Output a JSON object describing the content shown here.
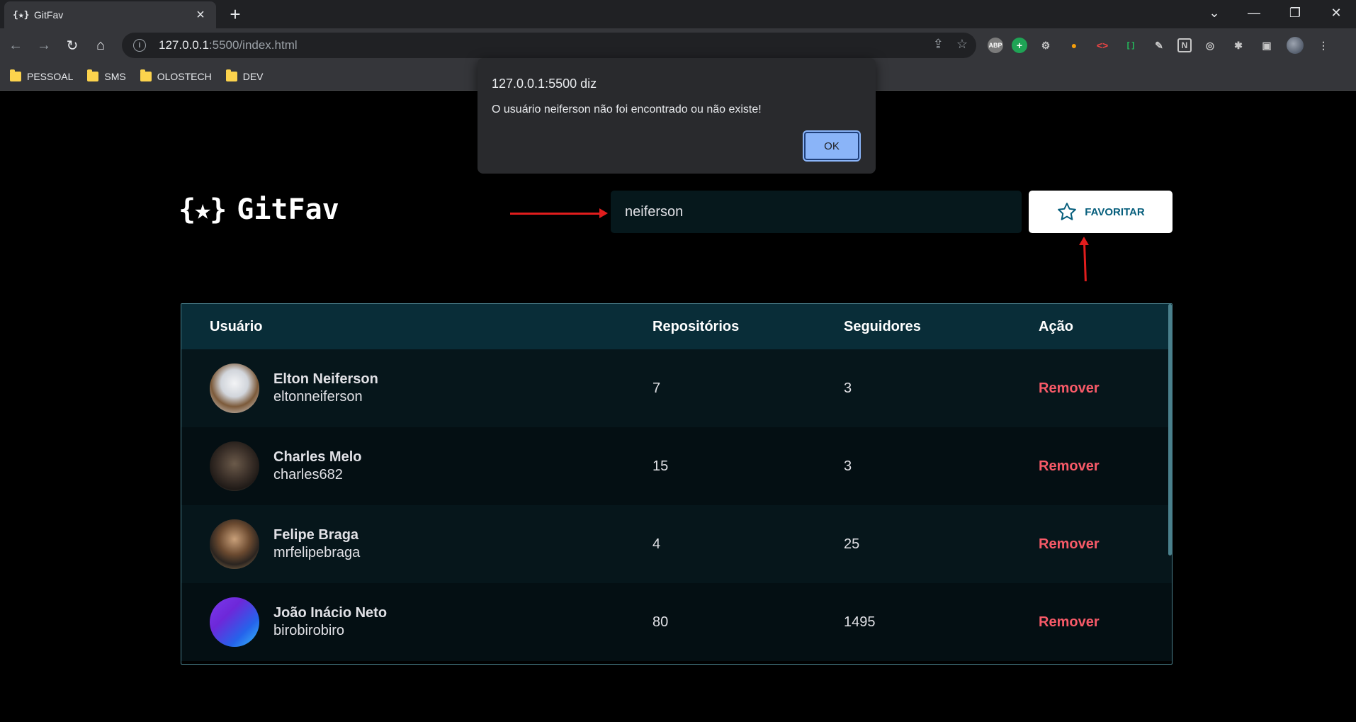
{
  "browser": {
    "tab_title": "GitFav",
    "tab_favicon": "{★}",
    "url_host": "127.0.0.1",
    "url_rest": ":5500/index.html",
    "bookmarks": [
      {
        "label": "PESSOAL"
      },
      {
        "label": "SMS"
      },
      {
        "label": "OLOSTECH"
      },
      {
        "label": "DEV"
      }
    ],
    "extensions": [
      "ABP",
      "+",
      "⚙",
      "●",
      "<>",
      "[ ]",
      "✎",
      "N",
      "◎",
      "✱",
      "▣"
    ]
  },
  "app": {
    "logo_mark": "{★}",
    "logo_text": "GitFav",
    "search_value": "neiferson",
    "favorite_label": "FAVORITAR",
    "accent_color": "#065e7c",
    "remove_color": "#f75a68"
  },
  "table": {
    "headers": {
      "user": "Usuário",
      "repos": "Repositórios",
      "followers": "Seguidores",
      "action": "Ação"
    },
    "rows": [
      {
        "name": "Elton Neiferson",
        "login": "eltonneiferson",
        "repos": "7",
        "followers": "3",
        "action": "Remover"
      },
      {
        "name": "Charles Melo",
        "login": "charles682",
        "repos": "15",
        "followers": "3",
        "action": "Remover"
      },
      {
        "name": "Felipe Braga",
        "login": "mrfelipebraga",
        "repos": "4",
        "followers": "25",
        "action": "Remover"
      },
      {
        "name": "João Inácio Neto",
        "login": "birobirobiro",
        "repos": "80",
        "followers": "1495",
        "action": "Remover"
      }
    ]
  },
  "dialog": {
    "title": "127.0.0.1:5500 diz",
    "message": "O usuário neiferson não foi encontrado ou não existe!",
    "ok_label": "OK"
  }
}
